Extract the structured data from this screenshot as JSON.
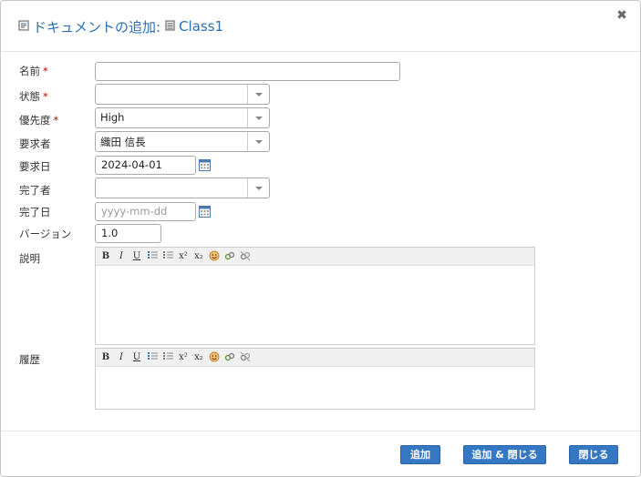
{
  "dialog": {
    "title_prefix": "ドキュメントの追加:",
    "title_class": "Class1",
    "close_glyph": "✖"
  },
  "fields": {
    "name": {
      "label": "名前",
      "value": ""
    },
    "status": {
      "label": "状態",
      "value": ""
    },
    "priority": {
      "label": "優先度",
      "value": "High"
    },
    "requester": {
      "label": "要求者",
      "value": "織田 信長"
    },
    "request_date": {
      "label": "要求日",
      "value": "2024-04-01"
    },
    "completer": {
      "label": "完了者",
      "value": ""
    },
    "completion_date": {
      "label": "完了日",
      "value": "",
      "placeholder": "yyyy-mm-dd"
    },
    "version": {
      "label": "バージョン",
      "value": "1.0"
    },
    "description": {
      "label": "説明",
      "value": ""
    },
    "history": {
      "label": "履歴",
      "value": ""
    }
  },
  "required_mark": "*",
  "editor_toolbar": [
    "B",
    "I",
    "U",
    "ol",
    "ul",
    "x²",
    "x₂",
    "emoji",
    "link",
    "unlink"
  ],
  "buttons": {
    "add": "追加",
    "add_close": "追加 & 閉じる",
    "close": "閉じる"
  },
  "colors": {
    "title": "#2a6fb5",
    "primary_button": "#3478c4",
    "required": "#cc0000"
  }
}
